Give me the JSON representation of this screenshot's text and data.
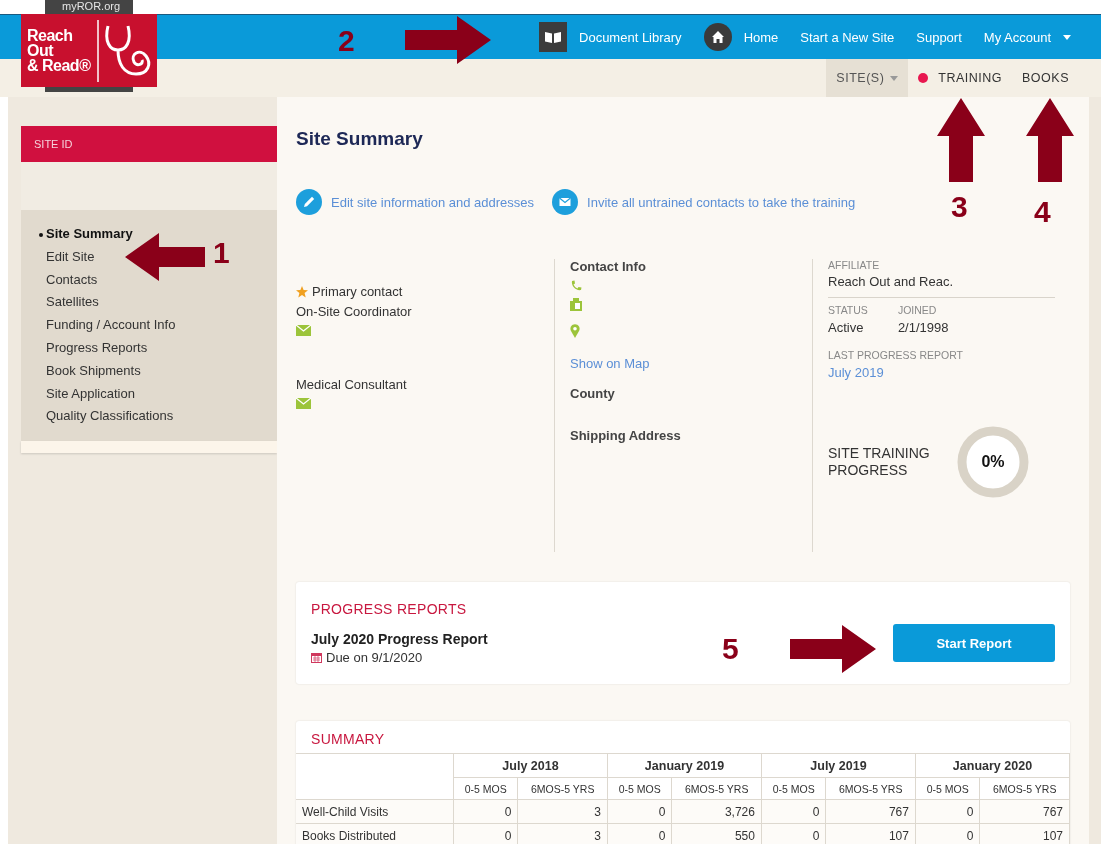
{
  "header": {
    "site_label": "myROR.org",
    "logo_lines": [
      "Reach",
      "Out",
      "& Read®"
    ],
    "nav": [
      {
        "label": "Document Library",
        "dropdown": false
      },
      {
        "label": "Home",
        "dropdown": false
      },
      {
        "label": "Start a New Site",
        "dropdown": false
      },
      {
        "label": "Support",
        "dropdown": false
      },
      {
        "label": "My Account",
        "dropdown": true
      }
    ]
  },
  "subnav": [
    {
      "label": "SITE(S)",
      "selected": true,
      "dropdown": true,
      "dot": false
    },
    {
      "label": "TRAINING",
      "selected": false,
      "dropdown": false,
      "dot": true
    },
    {
      "label": "BOOKS",
      "selected": false,
      "dropdown": false,
      "dot": false
    }
  ],
  "sidebar": {
    "header": "SITE ID",
    "items": [
      {
        "label": "Site Summary",
        "selected": true
      },
      {
        "label": "Edit Site",
        "selected": false
      },
      {
        "label": "Contacts",
        "selected": false
      },
      {
        "label": "Satellites",
        "selected": false
      },
      {
        "label": "Funding / Account Info",
        "selected": false
      },
      {
        "label": "Progress Reports",
        "selected": false
      },
      {
        "label": "Book Shipments",
        "selected": false
      },
      {
        "label": "Site Application",
        "selected": false
      },
      {
        "label": "Quality Classifications",
        "selected": false
      }
    ]
  },
  "main": {
    "title": "Site Summary",
    "actions": [
      {
        "label": "Edit site information and addresses"
      },
      {
        "label": "Invite all untrained contacts to take the training"
      }
    ],
    "contacts": [
      {
        "star_label": "Primary contact",
        "role": "On-Site Coordinator"
      },
      {
        "role": "Medical Consultant"
      }
    ],
    "contact_info": {
      "heading": "Contact Info",
      "map_link": "Show on Map",
      "county_heading": "County",
      "shipping_heading": "Shipping Address"
    },
    "site": {
      "affiliate_label": "AFFILIATE",
      "affiliate": "Reach Out and Reac.",
      "status_label": "STATUS",
      "status": "Active",
      "joined_label": "JOINED",
      "joined": "2/1/1998",
      "last_report_label": "LAST PROGRESS REPORT",
      "last_report": "July 2019",
      "training_label": "SITE TRAINING PROGRESS",
      "training_value": "0%"
    }
  },
  "progress_reports": {
    "title": "PROGRESS REPORTS",
    "report": "July 2020 Progress Report",
    "due": "Due on 9/1/2020",
    "button": "Start Report"
  },
  "summary": {
    "title": "SUMMARY",
    "groups": [
      {
        "label": "July 2018",
        "subcolumns": [
          "0-5 MOS",
          "6MOS-5 YRS"
        ]
      },
      {
        "label": "January 2019",
        "subcolumns": [
          "0-5 MOS",
          "6MOS-5 YRS"
        ]
      },
      {
        "label": "July 2019",
        "subcolumns": [
          "0-5 MOS",
          "6MOS-5 YRS"
        ]
      },
      {
        "label": "January 2020",
        "subcolumns": [
          "0-5 MOS",
          "6MOS-5 YRS"
        ]
      }
    ],
    "rows": [
      {
        "label": "Well-Child Visits",
        "cells": [
          "0",
          "3",
          "0",
          "3,726",
          "0",
          "767",
          "0",
          "767"
        ]
      },
      {
        "label": "Books Distributed",
        "cells": [
          "0",
          "3",
          "0",
          "550",
          "0",
          "107",
          "0",
          "107"
        ]
      }
    ]
  },
  "annotations": [
    {
      "label": "1"
    },
    {
      "label": "2"
    },
    {
      "label": "3"
    },
    {
      "label": "4"
    },
    {
      "label": "5"
    }
  ]
}
